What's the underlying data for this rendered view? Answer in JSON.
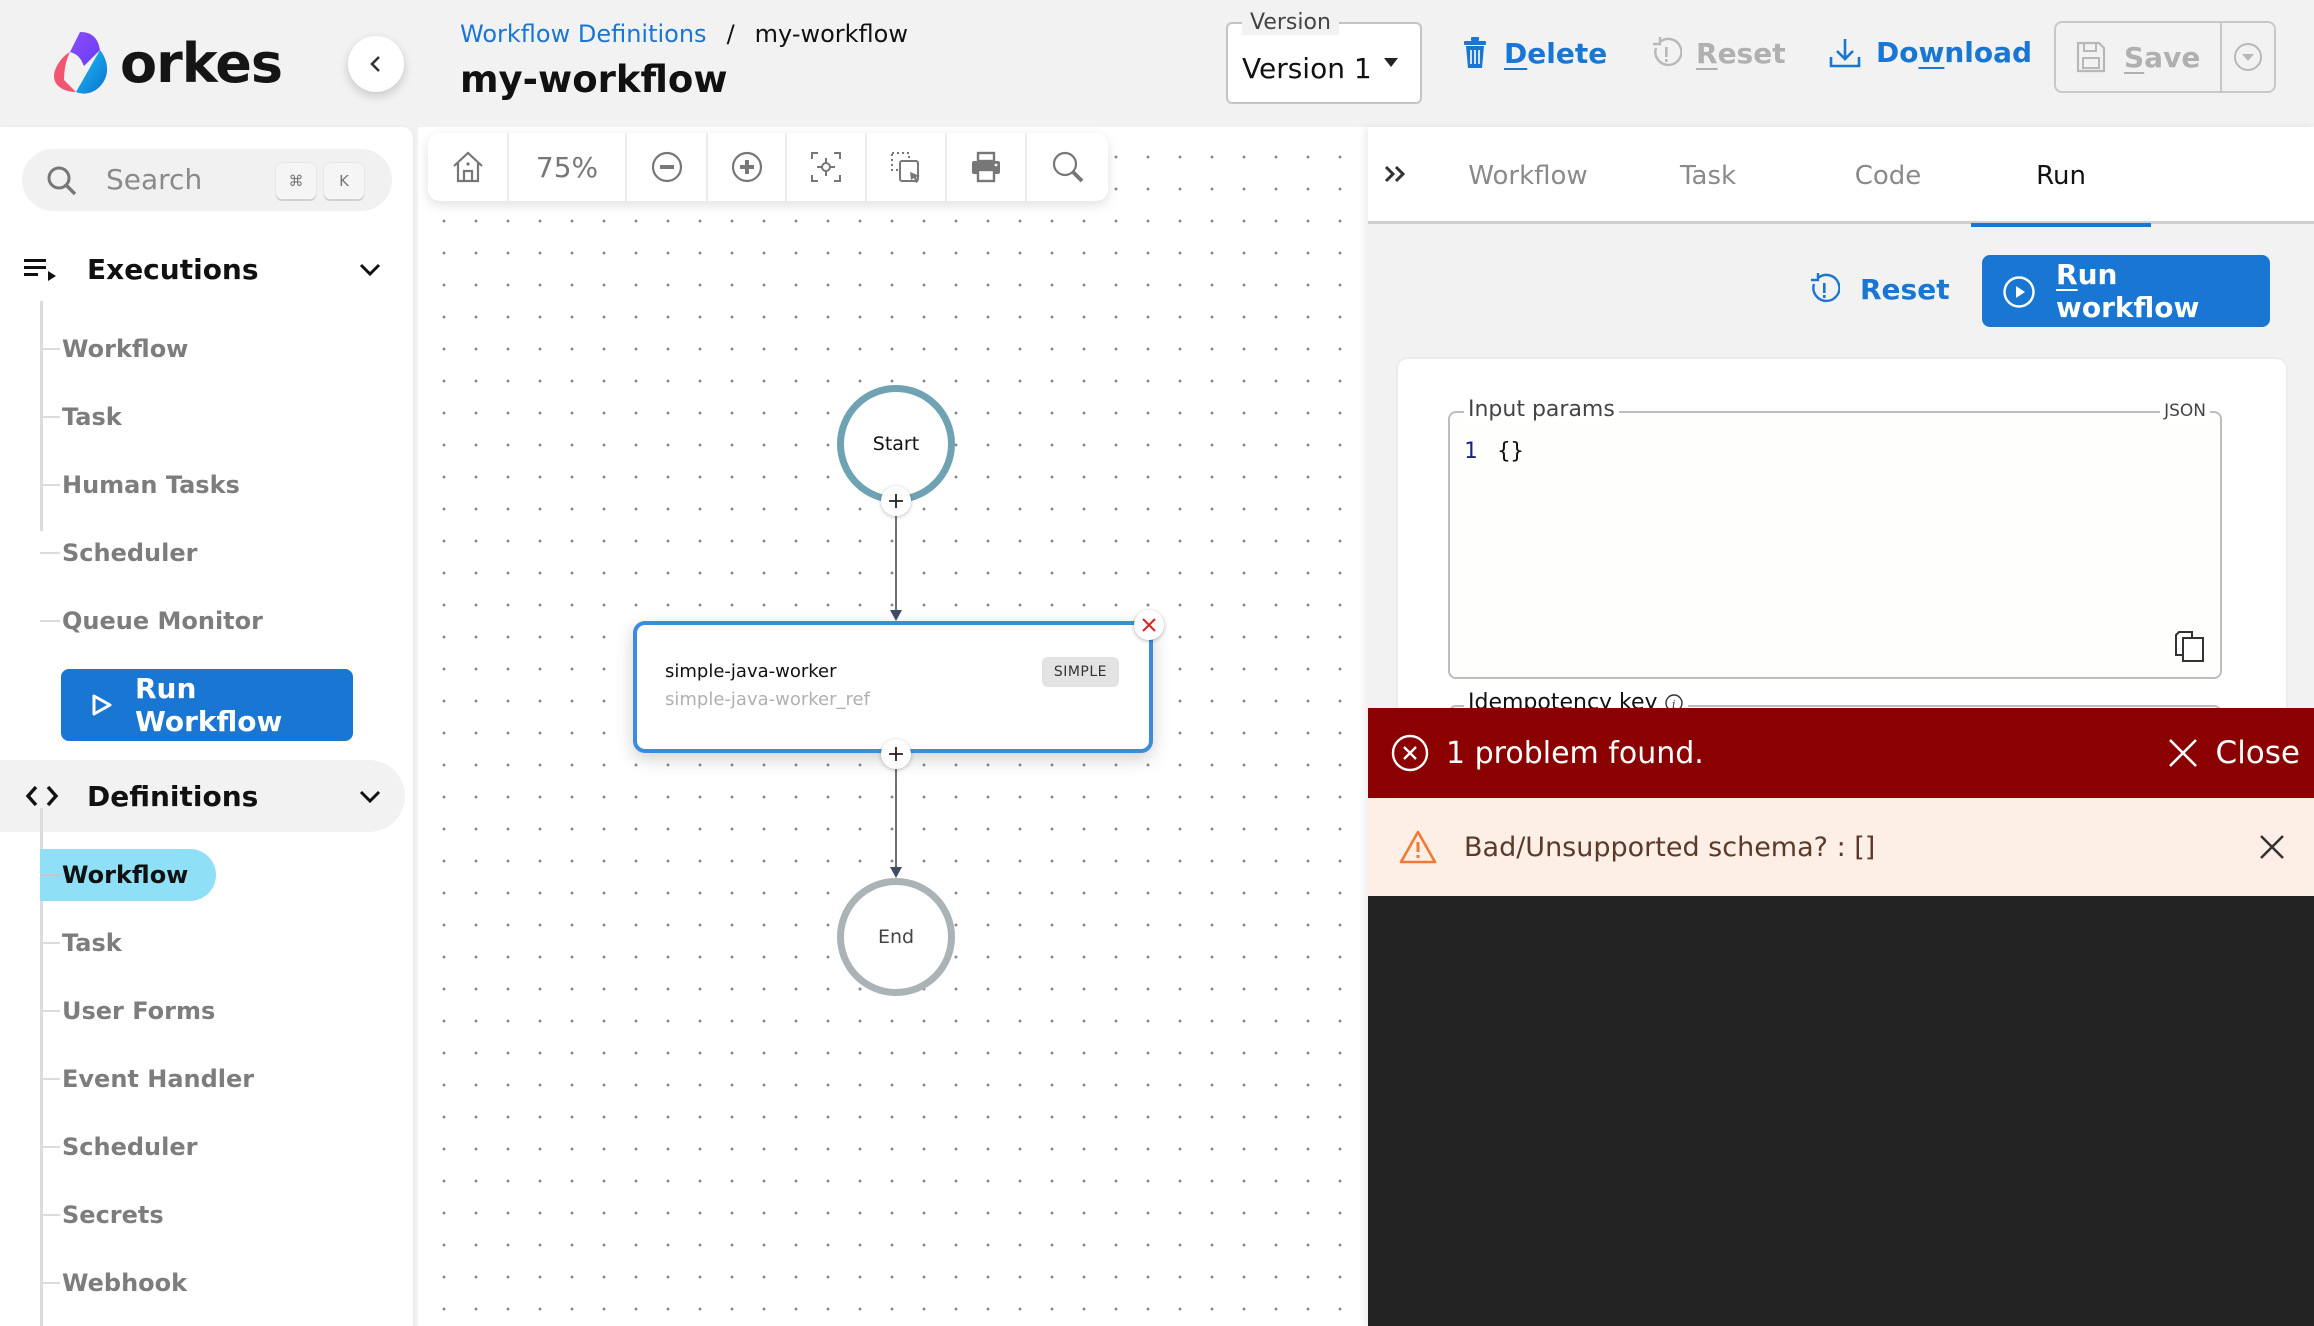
{
  "header": {
    "logo_text": "orkes",
    "breadcrumb": {
      "parent": "Workflow Definitions",
      "separator": "/",
      "current": "my-workflow"
    },
    "title": "my-workflow",
    "version": {
      "legend": "Version",
      "value": "Version 1"
    },
    "actions": {
      "delete": {
        "prefix": "",
        "underline": "D",
        "rest": "elete"
      },
      "reset": {
        "underline": "R",
        "rest": "eset"
      },
      "download": {
        "pre": "Do",
        "underline": "w",
        "rest": "nload"
      },
      "save": {
        "underline": "S",
        "rest": "ave"
      }
    }
  },
  "sidebar": {
    "search": {
      "placeholder": "Search",
      "shortcut_keys": [
        "⌘",
        "K"
      ]
    },
    "sections": [
      {
        "label": "Executions",
        "items": [
          "Workflow",
          "Task",
          "Human Tasks",
          "Scheduler",
          "Queue Monitor"
        ],
        "cta": "Run Workflow"
      },
      {
        "label": "Definitions",
        "items": [
          "Workflow",
          "Task",
          "User Forms",
          "Event Handler",
          "Scheduler",
          "Secrets",
          "Webhook"
        ],
        "selected": "Workflow"
      }
    ]
  },
  "canvas": {
    "zoom": "75%",
    "toolbar": [
      "home",
      "zoom-level",
      "zoom-out",
      "zoom-in",
      "fit-to-screen",
      "select-area",
      "print",
      "search"
    ],
    "nodes": {
      "start": "Start",
      "task": {
        "name": "simple-java-worker",
        "ref": "simple-java-worker_ref",
        "type": "SIMPLE"
      },
      "end": "End"
    }
  },
  "right_panel": {
    "tabs": [
      "Workflow",
      "Task",
      "Code",
      "Run"
    ],
    "active_tab": "Run",
    "reset_label": "Reset",
    "run_button": {
      "underline": "R",
      "rest": "un workflow"
    },
    "input_params": {
      "label": "Input params",
      "mode": "JSON",
      "line_number": "1",
      "code": "{}"
    },
    "idempotency_label": "Idempotency key",
    "problems": {
      "summary": "1 problem found.",
      "close_label": "Close",
      "items": [
        "Bad/Unsupported schema? : []"
      ]
    }
  },
  "colors": {
    "accent": "#1976d2",
    "selected_nav": "#8fe0f7",
    "error_bar": "#8b0000",
    "warning_bg": "#fdeee6",
    "warning_icon": "#f07a34",
    "start_ring": "#6fa3b4",
    "end_ring": "#aab3b6"
  }
}
